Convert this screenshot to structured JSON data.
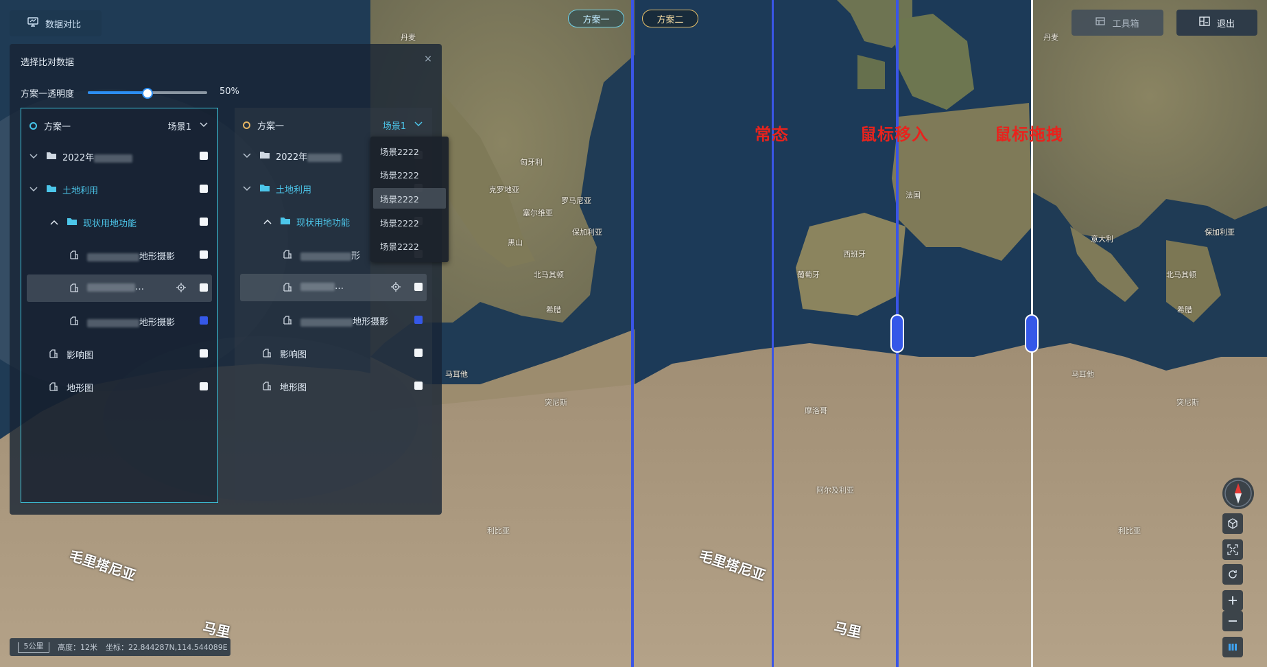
{
  "topbar": {
    "compare_btn": "数据对比",
    "scheme_tabs": [
      "方案一",
      "方案二"
    ],
    "toolbox": "工具箱",
    "exit": "退出"
  },
  "panel": {
    "title": "选择比对数据",
    "close": "×",
    "opacity_label": "方案一透明度",
    "opacity_value": "50%",
    "opacity_fraction": 0.5,
    "columns": [
      {
        "scheme": "方案一",
        "scene": "场景1",
        "rows": {
          "year": "2022年",
          "land_use": "土地利用",
          "current_func": "现状用地功能",
          "leaf1": "地形摄影",
          "leaf2": "…",
          "leaf3": "地形摄影",
          "influence": "影响图",
          "terrain": "地形图"
        }
      },
      {
        "scheme": "方案一",
        "scene": "场景1",
        "rows": {
          "year": "2022年",
          "land_use": "土地利用",
          "current_func": "现状用地功能",
          "leaf1": "形",
          "leaf2": "…",
          "leaf3": "地形摄影",
          "influence": "影响图",
          "terrain": "地形图"
        }
      }
    ],
    "dropdown_options": [
      "场景2222",
      "场景2222",
      "场景2222",
      "场景2222",
      "场景2222"
    ]
  },
  "states": {
    "normal": "常态",
    "hover": "鼠标移入",
    "drag": "鼠标拖拽"
  },
  "map_labels": {
    "denmark": "丹麦",
    "denmark2": "丹麦",
    "malta": "马耳他",
    "malta2": "马耳他",
    "tunisia": "突尼斯",
    "tunisia2": "突尼斯",
    "libya": "利比亚",
    "libya2": "利比亚",
    "mauritania": "毛里塔尼亚",
    "mauritania2": "毛里塔尼亚",
    "mali": "马里",
    "mali2": "马里",
    "algeria": "阿尔及利亚",
    "spain": "西班牙",
    "portugal": "葡萄牙",
    "france": "法国",
    "morocco": "摩洛哥",
    "italy": "意大利",
    "greece": "希腊",
    "croatia": "克罗地亚",
    "serbia": "塞尔维亚",
    "bulgaria": "保加利亚",
    "romania": "罗马尼亚",
    "montenegro": "黑山",
    "north_macedonia": "北马其顿",
    "hungary": "匈牙利",
    "greece2": "希腊",
    "bulgaria2": "保加利亚",
    "north_macedonia2": "北马其顿"
  },
  "status": {
    "scale": "5公里",
    "height": "高度：12米",
    "coords": "坐标：22.844287N,114.544089E"
  },
  "colors": {
    "accent_cyan": "#3ec8df",
    "handle_blue": "#3558e8",
    "caption_red": "#e8231d"
  }
}
